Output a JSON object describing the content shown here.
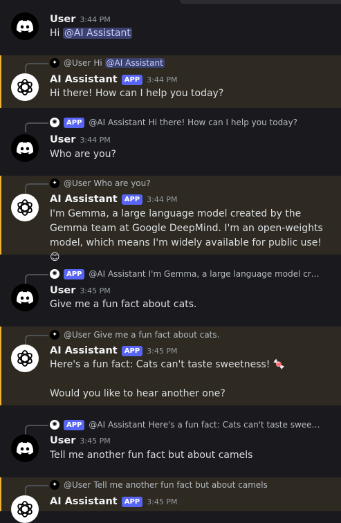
{
  "messages": [
    {
      "author": "User",
      "time": "3:44 PM",
      "text_prefix": "Hi ",
      "mention": "@AI Assistant"
    },
    {
      "reply_author": "@User",
      "reply_text": "Hi ",
      "reply_mention": "@AI Assistant",
      "author": "AI Assistant",
      "tag": "APP",
      "time": "3:44 PM",
      "text": "Hi there! How can I help you today?"
    },
    {
      "reply_tag": "APP",
      "reply_author": "@AI Assistant",
      "reply_text": "Hi there! How can I help you today?",
      "author": "User",
      "time": "3:44 PM",
      "text": "Who are you?"
    },
    {
      "reply_author": "@User",
      "reply_text": "Who are you?",
      "author": "AI Assistant",
      "tag": "APP",
      "time": "3:44 PM",
      "text": "I'm Gemma, a large language model created by the Gemma team at Google DeepMind. I'm an open-weights model, which means I'm widely available for public use! 😊"
    },
    {
      "reply_tag": "APP",
      "reply_author": "@AI Assistant",
      "reply_text": "I'm Gemma, a large language model created by the Gemma team at Google DeepMind. I'm an open-weights model, which means I'm widely available for public use!",
      "author": "User",
      "time": "3:45 PM",
      "text": "Give me a fun fact about cats."
    },
    {
      "reply_author": "@User",
      "reply_text": "Give me a fun fact about cats.",
      "author": "AI Assistant",
      "tag": "APP",
      "time": "3:45 PM",
      "text": "Here's a fun fact: Cats can't taste sweetness! 🍬",
      "text2": "Would you like to hear another one?"
    },
    {
      "reply_tag": "APP",
      "reply_author": "@AI Assistant",
      "reply_text": "Here's a fun fact: Cats can't taste sweetness!",
      "author": "User",
      "time": "3:45 PM",
      "text": "Tell me another fun fact but about camels"
    },
    {
      "reply_author": "@User",
      "reply_text": "Tell me another fun fact but about camels",
      "author": "AI Assistant",
      "tag": "APP",
      "time": "3:45 PM"
    }
  ]
}
